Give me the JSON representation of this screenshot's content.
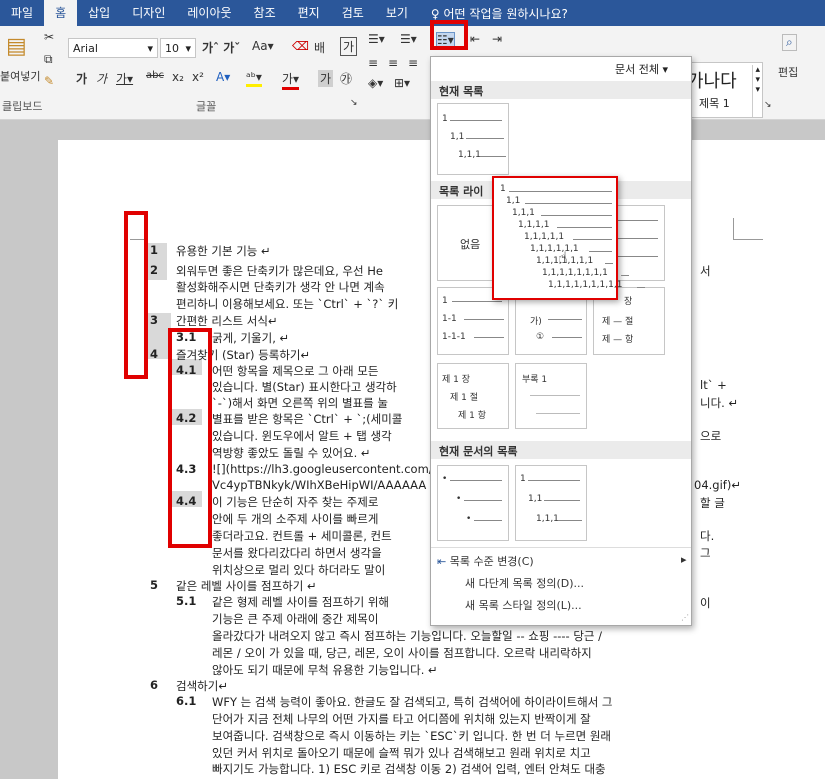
{
  "ribbon": {
    "tabs": [
      "파일",
      "홈",
      "삽입",
      "디자인",
      "레이아웃",
      "참조",
      "편지",
      "검토",
      "보기"
    ],
    "tell_me": "어떤 작업을 원하시나요?",
    "font_name": "Arial",
    "font_size": "10",
    "clipboard_label": "클립보드",
    "font_group_label": "글꼴",
    "paste_label": "붙여넣기",
    "edit_label": "편집",
    "style_gana": "가나다",
    "style_heading": "제목 1",
    "doc_scope": "문서 전체"
  },
  "dropdown": {
    "current_list": "현재 목록",
    "list_library": "목록 라이",
    "none_label": "없음",
    "current_doc_lists": "현재 문서의 목록",
    "menu": {
      "change_level": "목록 수준 변경(C)",
      "define_new_multilevel": "새 다단계 목록 정의(D)...",
      "define_new_style": "새 목록 스타일 정의(L)..."
    },
    "tile_current": [
      "1",
      "1,1",
      "1,1,1"
    ],
    "tile_a": [
      "1",
      "1-1",
      "1-1-1"
    ],
    "tile_b": [
      "가)",
      "①"
    ],
    "tile_c": [
      "장",
      "제 — 절",
      "제 — 항"
    ],
    "tile_d": [
      "제 1 장",
      "제 1 절",
      "제 1 항"
    ],
    "tile_e": [
      "부록 1"
    ],
    "tile_doc2": [
      "1",
      "1,1",
      "1,1,1"
    ]
  },
  "popup": {
    "levels": [
      "1",
      "1,1",
      "1,1,1",
      "1,1,1,1",
      "1,1,1,1,1",
      "1,1,1,1,1,1",
      "1,1,1,1,1,1,1",
      "1,1,1,1,1,1,1,1",
      "1,1,1,1,1,1,1,1,1"
    ]
  },
  "document": {
    "lines": [
      {
        "num": "1",
        "text": "유용한 기본 기능 ↵"
      },
      {
        "num": "2",
        "text": "외워두면 좋은 단축키가 많은데요, 우선 He"
      },
      {
        "num": "",
        "text": "활성화해주시면 단축키가 생각 안 나면 계속"
      },
      {
        "num": "",
        "text": "편리하니 이용해보세요. 또는 `Ctrl` + `?` 키"
      },
      {
        "num": "3",
        "text": "간편한 리스트 서식↵"
      },
      {
        "num": "3.1",
        "text": "굵게, 기울기, ↵"
      },
      {
        "num": "4",
        "text": "즐겨찾기 (Star) 등록하기↵"
      },
      {
        "num": "4.1",
        "text": "어떤 항목을 제목으로 그 아래 모든"
      },
      {
        "num": "",
        "text": "있습니다. 별(Star) 표시한다고 생각하"
      },
      {
        "num": "",
        "text": "`-`)해서 화면 오른쪽 위의 별표를 눌"
      },
      {
        "num": "4.2",
        "text": "별표를 받은 항목은 `Ctrl` + `;(세미콜"
      },
      {
        "num": "",
        "text": "있습니다. 윈도우에서 알트 + 탭 생각"
      },
      {
        "num": "",
        "text": "역방향 좋았도 돌릴 수 있어요. ↵"
      },
      {
        "num": "4.3",
        "text": "![](https://lh3.googleusercontent.com/-"
      },
      {
        "num": "",
        "text": "Vc4ypTBNkyk/WIhXBeHipWI/AAAAAA"
      },
      {
        "num": "4.4",
        "text": "이 기능은 단순히 자주 찾는 주제로"
      },
      {
        "num": "",
        "text": "안에 두 개의 소주제 사이를 빠르게"
      },
      {
        "num": "",
        "text": "좋더라고요. 컨트롤 + 세미콜론, 컨트"
      },
      {
        "num": "",
        "text": "문서를 왔다리갔다리 하면서 생각을"
      },
      {
        "num": "",
        "text": "위치상으로 멀리 있다 하더라도 말이"
      },
      {
        "num": "5",
        "text": "같은 레벨 사이를 점프하기 ↵"
      },
      {
        "num": "5.1",
        "text": "같은 형제 레벨 사이를 점프하기 위해"
      },
      {
        "num": "",
        "text": "기능은 큰 주제 아래에 중간 제목이"
      },
      {
        "num": "",
        "text": "올라갔다가 내려오지 않고 즉시 점프하는 기능입니다. 오늘할일 -- 쇼핑 ---- 당근 /"
      },
      {
        "num": "",
        "text": "레몬 / 오이 가 있을 때, 당근, 레몬, 오이 사이를 점프합니다. 오르락 내리락하지"
      },
      {
        "num": "",
        "text": "않아도 되기 때문에 무척 유용한 기능입니다. ↵"
      },
      {
        "num": "6",
        "text": "검색하기↵"
      },
      {
        "num": "6.1",
        "text": "WFY 는 검색 능력이 좋아요. 한글도 잘 검색되고, 특히 검색어에 하이라이트해서 그"
      },
      {
        "num": "",
        "text": "단어가 지금 전체 나무의 어떤 가지를 타고 어디쯤에 위치해 있는지 반짝이게 잘"
      },
      {
        "num": "",
        "text": "보여줍니다. 검색창으로 즉시 이동하는 키는 `ESC`키 입니다. 한 번 더 누르면 원래"
      },
      {
        "num": "",
        "text": "있던 커서 위치로 돌아오기 때문에 슬쩍 뭐가 있나 검색해보고 원래 위치로 치고"
      },
      {
        "num": "",
        "text": "빠지기도 가능합니다. 1) ESC 키로 검색창 이동 2) 검색어 입력, 엔터 안쳐도 대충"
      }
    ],
    "right_fragments": {
      "r1": "서",
      "r2": "lt` +",
      "r3": "니다. ↵",
      "r4": "으로",
      "r5": "04.gif)↵",
      "r6": "할 글",
      "r7": "다.",
      "r8": "그",
      "r9": "이"
    }
  }
}
